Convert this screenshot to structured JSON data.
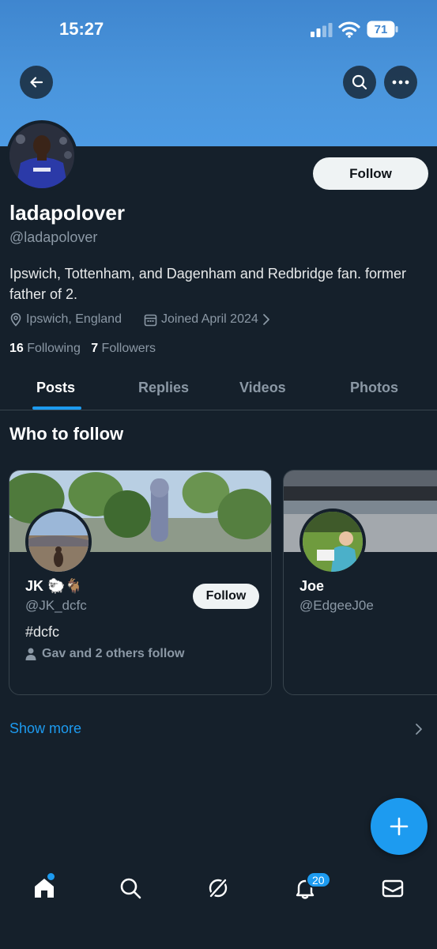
{
  "status_bar": {
    "time": "15:27",
    "battery": "71"
  },
  "profile": {
    "display_name": "ladapolover",
    "handle": "@ladapolover",
    "follow_label": "Follow",
    "bio": "Ipswich, Tottenham, and Dagenham and Redbridge fan. former father of 2.",
    "location": "Ipswich, England",
    "joined": "Joined April 2024",
    "following_count": "16",
    "following_label": "Following",
    "followers_count": "7",
    "followers_label": "Followers"
  },
  "tabs": [
    {
      "label": "Posts",
      "active": true
    },
    {
      "label": "Replies",
      "active": false
    },
    {
      "label": "Videos",
      "active": false
    },
    {
      "label": "Photos",
      "active": false
    }
  ],
  "who_to_follow": {
    "title": "Who to follow",
    "cards": [
      {
        "name": "JK 🐑🐐",
        "handle": "@JK_dcfc",
        "bio": "#dcfc",
        "social_context": "Gav and 2 others follow",
        "follow_label": "Follow"
      },
      {
        "name": "Joe",
        "handle": "@EdgeeJ0e"
      }
    ],
    "show_more": "Show more"
  },
  "nav": {
    "notifications_badge": "20"
  },
  "colors": {
    "background": "#15202b",
    "accent": "#1d9bf0",
    "banner": "#4a95dc",
    "muted": "#8b98a5"
  }
}
